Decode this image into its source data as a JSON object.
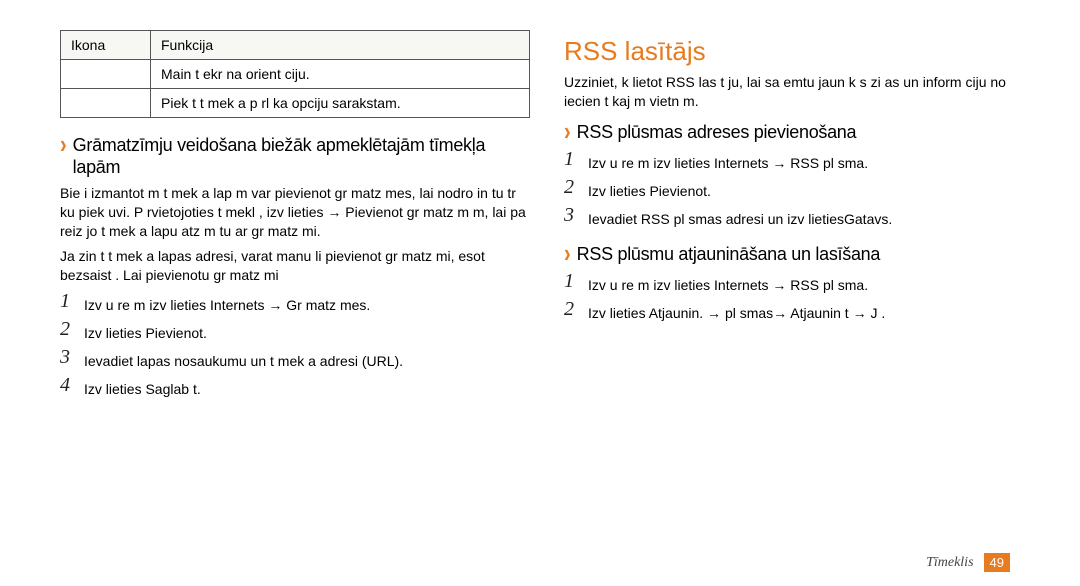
{
  "table": {
    "head": {
      "c1": "Ikona",
      "c2": "Funkcija"
    },
    "rows": [
      {
        "c2": "Main t ekr na orient ciju."
      },
      {
        "c2": "Piek  t t mek a p rl ka opciju sarakstam."
      }
    ]
  },
  "left": {
    "heading": "Grāmatzīmju veidošana biežāk apmeklētajām tīmekļa lapām",
    "para1": "Bie i izmantot m t mek a lap m var pievienot gr matz mes, lai nodro in tu  tr ku piek uvi. P rvietojoties t mekl , izv lieties   → Pievienot gr matz m m, lai pa reiz jo t mek a lapu atz m tu ar gr matz mi.",
    "para2": "Ja zin t t mek a lapas adresi, varat manu li pievienot gr matz mi, esot bezsaist . Lai pievienotu gr matz mi",
    "steps": [
      "Izv  u re m  izv lieties  Internets → Gr matz mes.",
      "Izv lieties Pievienot.",
      "Ievadiet lapas nosaukumu un t mek a adresi (URL).",
      "Izv lieties Saglab t."
    ]
  },
  "right": {
    "title": "RSS lasītājs",
    "intro": "Uzziniet, k  lietot RSS las t ju, lai sa emtu jaun k s zi as un inform ciju no iecien t kaj m vietn m.",
    "sec1": {
      "heading": "RSS plūsmas adreses pievienošana",
      "steps": [
        "Izv  u re m  izv lieties  Internets → RSS pl sma.",
        "Izv lieties Pievienot.",
        "Ievadiet RSS pl smas adresi un izv lietiesGatavs."
      ]
    },
    "sec2": {
      "heading": "RSS plūsmu atjaunināšana un lasīšana",
      "steps": [
        "Izv  u re m  izv lieties  Internets → RSS pl sma.",
        "Izv lieties Atjaunin. → pl smas→ Atjaunin t  → J ."
      ]
    }
  },
  "footer": {
    "label": "Tīmeklis",
    "page": "49"
  }
}
